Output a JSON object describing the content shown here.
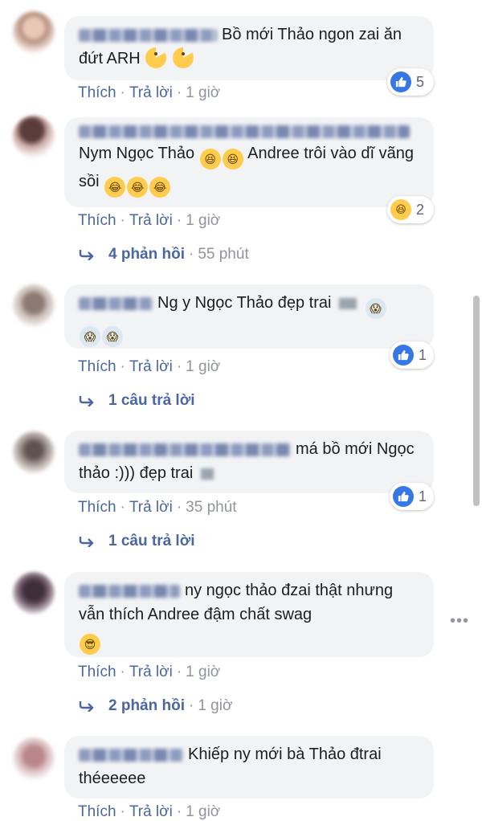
{
  "comments": [
    {
      "text": "Bồ mới Thảo ngon zai ăn đứt ARH",
      "actions": {
        "like": "Thích",
        "reply": "Trả lời",
        "time": "1 giờ"
      },
      "reaction": {
        "type": "like",
        "count": "5"
      }
    },
    {
      "text": "Nym Ngọc Thảo",
      "text2": "Andree trôi vào dĩ vãng sồi",
      "actions": {
        "like": "Thích",
        "reply": "Trả lời",
        "time": "1 giờ"
      },
      "reaction": {
        "type": "haha",
        "count": "2"
      },
      "replies": {
        "label": "4 phản hồi",
        "time": "55 phút"
      }
    },
    {
      "text": "Ng y Ngọc Thảo đẹp trai",
      "actions": {
        "like": "Thích",
        "reply": "Trả lời",
        "time": "1 giờ"
      },
      "reaction": {
        "type": "like",
        "count": "1"
      },
      "replies": {
        "label": "1 câu trả lời"
      }
    },
    {
      "text": "má bồ mới Ngọc thảo :))) đẹp trai",
      "actions": {
        "like": "Thích",
        "reply": "Trả lời",
        "time": "35 phút"
      },
      "reaction": {
        "type": "like",
        "count": "1"
      },
      "replies": {
        "label": "1 câu trả lời"
      }
    },
    {
      "text": "ny ngọc thảo đzai thật nhưng vẫn thích Andree đậm chất swag",
      "actions": {
        "like": "Thích",
        "reply": "Trả lời",
        "time": "1 giờ"
      },
      "replies": {
        "label": "2 phản hồi",
        "time": "1 giờ"
      }
    },
    {
      "text": "Khiếp ny mới bà Thảo đtrai théeeeee",
      "actions": {
        "like": "Thích",
        "reply": "Trả lời",
        "time": "1 giờ"
      }
    }
  ],
  "more_options": "•••",
  "colors": {
    "link": "#4b67a1",
    "meta": "#90949c",
    "bubble": "#f2f3f5",
    "like": "#3578e5"
  }
}
